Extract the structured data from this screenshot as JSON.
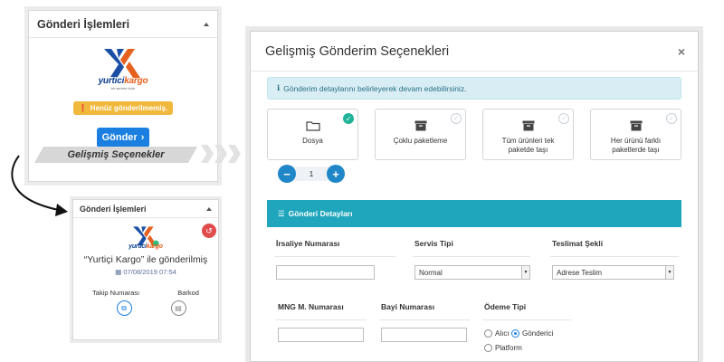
{
  "panel1": {
    "title": "Gönderi İşlemleri",
    "logo_brand": "yurtici",
    "logo_brand2": "kargo",
    "logo_sub": "bir serinin ürün",
    "warning_text": "Henüz gönderilmemiş.",
    "send_label": "Gönder",
    "advanced_label": "Gelişmiş Seçenekler"
  },
  "panel2": {
    "title": "Gönderi İşlemleri",
    "logo_brand": "yurtici",
    "logo_brand2": "kargo",
    "sent_text": "“Yurtiçi Kargo” ile gönderilmiş",
    "sent_date": "07/08/2019 07:54",
    "tracking_label": "Takip Numarası",
    "barcode_label": "Barkod"
  },
  "modal": {
    "title": "Gelişmiş Gönderim Seçenekleri",
    "close": "×",
    "info_text": "Gönderim detaylarını belirleyerek devam edebilirsiniz.",
    "options": [
      {
        "label": "Dosya",
        "selected": true,
        "icon": "folder-icon"
      },
      {
        "label": "Çoklu paketleme",
        "selected": false,
        "icon": "box-icon"
      },
      {
        "label": "Tüm ürünleri tek paketde taşı",
        "selected": false,
        "icon": "box-icon"
      },
      {
        "label": "Her ürünü farklı paketlerde taşı",
        "selected": false,
        "icon": "box-icon"
      }
    ],
    "stepper": {
      "minus": "−",
      "value": "1",
      "plus": "+"
    },
    "section_title": "Gönderi Detayları",
    "fields": {
      "irsaliye_label": "İrsaliye Numarası",
      "servis_label": "Servis Tipi",
      "servis_value": "Normal",
      "teslimat_label": "Teslimat Şekli",
      "teslimat_value": "Adrese Teslim",
      "mng_label": "MNG M. Numarası",
      "bayi_label": "Bayi Numarası",
      "odeme_label": "Ödeme Tipi",
      "odeme_options": [
        {
          "label": "Alıcı",
          "selected": false
        },
        {
          "label": "Gönderici",
          "selected": true
        },
        {
          "label": "Platform",
          "selected": false
        }
      ]
    }
  },
  "colors": {
    "brand_blue": "#1a7fe0",
    "teal": "#1fa6bd",
    "check_green": "#1fb39a",
    "warning": "#f0b83c",
    "danger": "#e04b4b"
  }
}
